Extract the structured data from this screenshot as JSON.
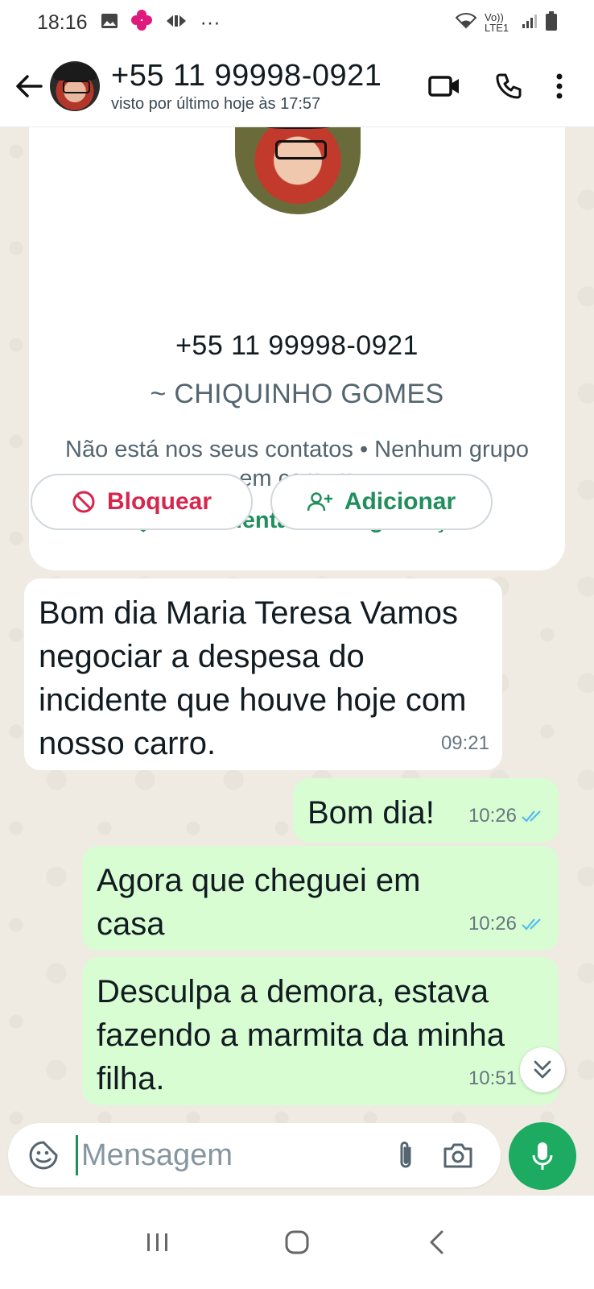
{
  "status_bar": {
    "time": "18:16",
    "more": "···",
    "network": "Vo)) LTE1"
  },
  "header": {
    "contact_phone": "+55 11 99998-0921",
    "last_seen": "visto por último hoje às 17:57",
    "icons": [
      "back-arrow-icon",
      "video-call-icon",
      "phone-icon",
      "more-vertical-icon"
    ]
  },
  "info_card": {
    "phone": "+55 11 99998-0921",
    "name": "~ CHIQUINHO GOMES",
    "note": "Não está nos seus contatos • Nenhum grupo em comum",
    "safety_link": "Ferramentas de segurança",
    "block_label": "Bloquear",
    "add_label": "Adicionar"
  },
  "messages": [
    {
      "direction": "in",
      "text": "Bom dia Maria Teresa Vamos negociar a despesa do incidente que houve hoje com nosso carro.",
      "time": "09:21"
    },
    {
      "direction": "out",
      "text": "Bom dia!",
      "time": "10:26",
      "status": "read"
    },
    {
      "direction": "out",
      "text": "Agora que cheguei em casa",
      "time": "10:26",
      "status": "read"
    },
    {
      "direction": "out",
      "text": "Desculpa a demora, estava fazendo a marmita da minha filha.",
      "time": "10:51",
      "status": "read"
    }
  ],
  "composer": {
    "placeholder": "Mensagem"
  },
  "colors": {
    "accent_green": "#1f8f5c",
    "mic_green": "#1daa61",
    "block_red": "#d7264d",
    "outgoing_bubble": "#d9fdd3",
    "read_ticks": "#53bdeb",
    "chat_bg": "#efeae2"
  }
}
